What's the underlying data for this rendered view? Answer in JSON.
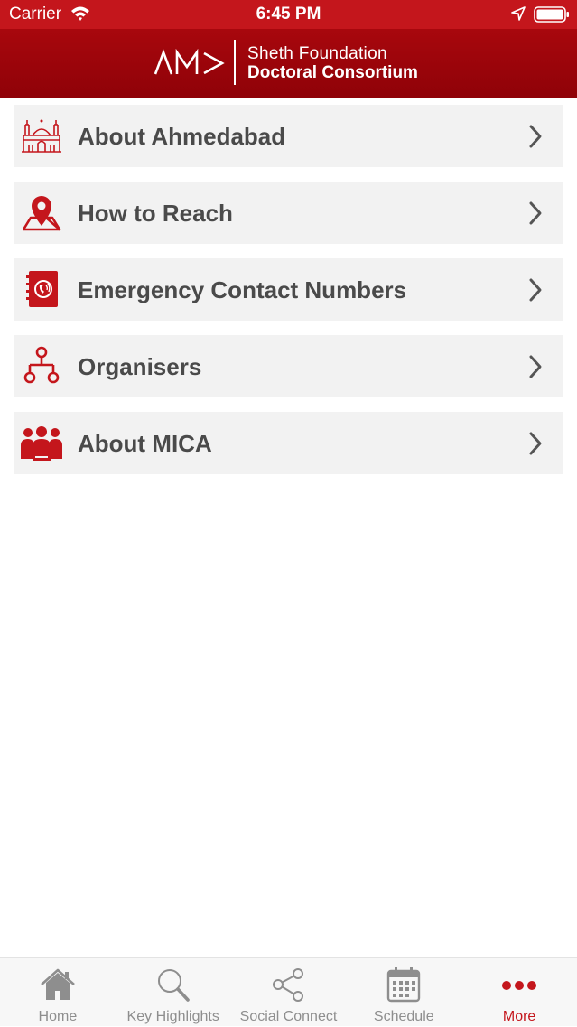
{
  "status_bar": {
    "carrier": "Carrier",
    "time": "6:45 PM"
  },
  "header": {
    "logo_text": "AM>",
    "line1": "Sheth Foundation",
    "line2": "Doctoral Consortium"
  },
  "menu": {
    "items": [
      {
        "label": "About Ahmedabad",
        "icon": "mosque-icon"
      },
      {
        "label": "How to Reach",
        "icon": "map-pin-icon"
      },
      {
        "label": "Emergency Contact Numbers",
        "icon": "phone-book-icon"
      },
      {
        "label": "Organisers",
        "icon": "org-chart-icon"
      },
      {
        "label": "About MICA",
        "icon": "group-icon"
      }
    ]
  },
  "tab_bar": {
    "tabs": [
      {
        "label": "Home",
        "icon": "home-icon",
        "active": false
      },
      {
        "label": "Key Highlights",
        "icon": "magnifier-icon",
        "active": false
      },
      {
        "label": "Social Connect",
        "icon": "share-icon",
        "active": false
      },
      {
        "label": "Schedule",
        "icon": "calendar-icon",
        "active": false
      },
      {
        "label": "More",
        "icon": "more-dots-icon",
        "active": true
      }
    ]
  },
  "colors": {
    "brand_red": "#c4161c",
    "header_dark_red": "#8f0208",
    "menu_bg": "#f2f2f2",
    "text_dark": "#4a4a4a",
    "tab_inactive": "#8e8e8e"
  }
}
